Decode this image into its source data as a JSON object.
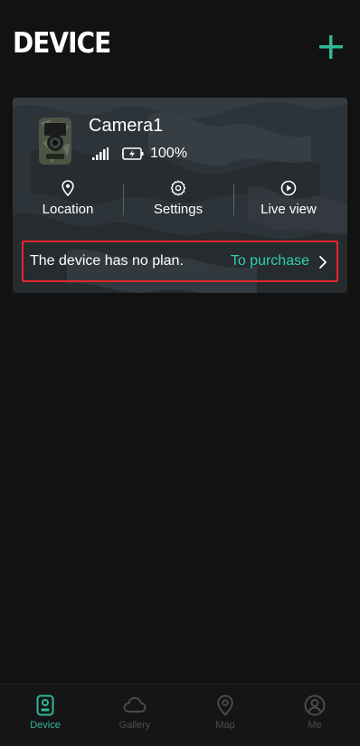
{
  "header": {
    "title": "DEVICE",
    "add_icon": "plus-icon"
  },
  "device_card": {
    "name": "Camera1",
    "signal_icon": "signal-bars-icon",
    "battery_icon": "battery-charging-icon",
    "battery_level": "100%",
    "actions": [
      {
        "label": "Location",
        "icon": "location-pin-icon"
      },
      {
        "label": "Settings",
        "icon": "gear-icon"
      },
      {
        "label": "Live view",
        "icon": "play-circle-icon"
      }
    ],
    "plan_notice": "The device has no plan.",
    "purchase_link": "To purchase"
  },
  "tabs": [
    {
      "label": "Device",
      "icon": "device-icon",
      "active": true
    },
    {
      "label": "Gallery",
      "icon": "cloud-icon",
      "active": false
    },
    {
      "label": "Map",
      "icon": "map-pin-icon",
      "active": false
    },
    {
      "label": "Me",
      "icon": "user-circle-icon",
      "active": false
    }
  ],
  "colors": {
    "background": "#121212",
    "accent": "#2fd0b0",
    "highlight_border": "#e3262b",
    "inactive_tab": "#4d4d4d"
  }
}
